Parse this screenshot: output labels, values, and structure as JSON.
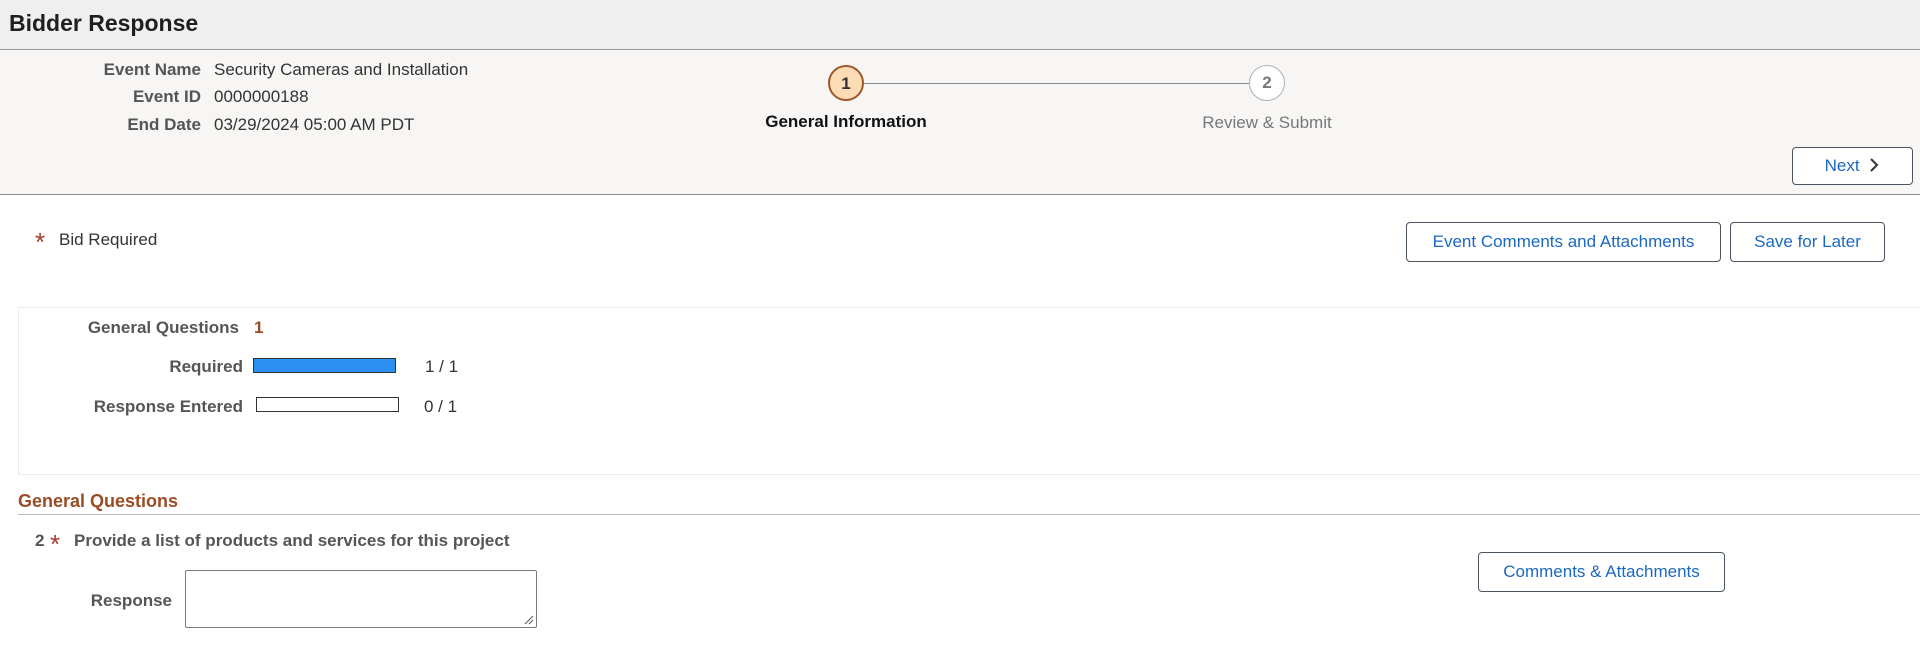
{
  "page": {
    "title": "Bidder Response"
  },
  "event": {
    "name_label": "Event Name",
    "name_value": "Security Cameras and Installation",
    "id_label": "Event ID",
    "id_value": "0000000188",
    "end_label": "End Date",
    "end_value": "03/29/2024 05:00 AM PDT"
  },
  "steps": [
    {
      "number": "1",
      "label": "General Information",
      "state": "current"
    },
    {
      "number": "2",
      "label": "Review & Submit",
      "state": "upcoming"
    }
  ],
  "nav": {
    "next_label": "Next",
    "next_icon": "chevron-right-icon"
  },
  "actions": {
    "bid_required_label": "Bid Required",
    "event_comments_label": "Event Comments and Attachments",
    "save_later_label": "Save for Later"
  },
  "summary": {
    "heading_label": "General Questions",
    "heading_count": "1",
    "required_label": "Required",
    "required_text": "1 / 1",
    "required_fraction": 1.0,
    "response_label": "Response Entered",
    "response_text": "0 / 1",
    "response_fraction": 0.0
  },
  "section": {
    "title": "General Questions",
    "question_number": "2",
    "question_text": "Provide a list of products and services for this project",
    "response_label": "Response",
    "response_value": "",
    "comments_label": "Comments & Attachments"
  },
  "colors": {
    "accent": "#1a68c2",
    "required_star": "#a8392b",
    "section_title": "#9b4c24",
    "progress_fill": "#2a8ff0",
    "step_active": "#fcdcb4"
  }
}
